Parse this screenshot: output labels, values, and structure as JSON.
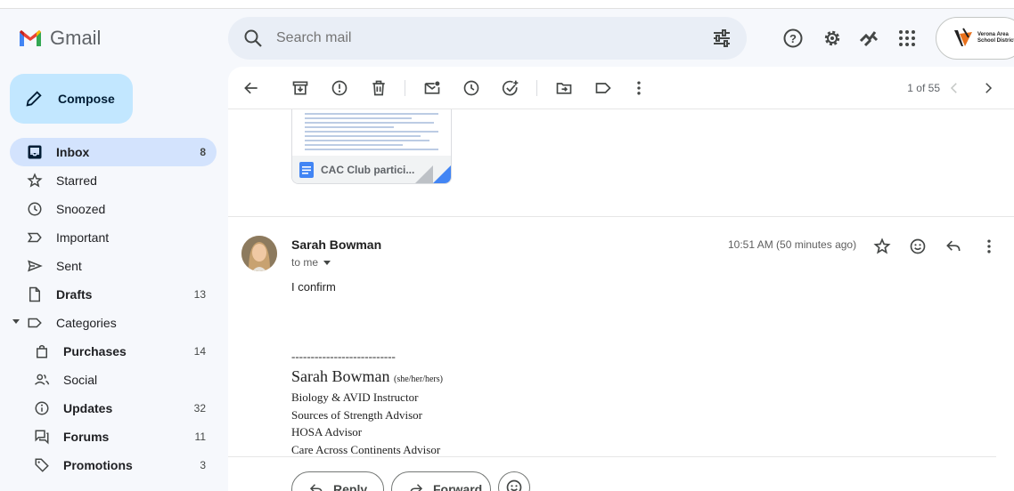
{
  "app": {
    "name": "Gmail"
  },
  "search": {
    "placeholder": "Search mail"
  },
  "account": {
    "org": "Verona Area School District"
  },
  "compose": {
    "label": "Compose"
  },
  "sidebar": {
    "items": [
      {
        "label": "Inbox",
        "count": "8"
      },
      {
        "label": "Starred",
        "count": ""
      },
      {
        "label": "Snoozed",
        "count": ""
      },
      {
        "label": "Important",
        "count": ""
      },
      {
        "label": "Sent",
        "count": ""
      },
      {
        "label": "Drafts",
        "count": "13"
      },
      {
        "label": "Categories",
        "count": ""
      },
      {
        "label": "Purchases",
        "count": "14"
      },
      {
        "label": "Social",
        "count": ""
      },
      {
        "label": "Updates",
        "count": "32"
      },
      {
        "label": "Forums",
        "count": "11"
      },
      {
        "label": "Promotions",
        "count": "3"
      }
    ]
  },
  "toolbar": {
    "pager": "1 of 55"
  },
  "attachment": {
    "name": "CAC Club partici..."
  },
  "message": {
    "sender": "Sarah Bowman",
    "to": "to me",
    "time": "10:51 AM (50 minutes ago)",
    "body": "I confirm",
    "signature": {
      "dashes": "---------------------------",
      "name": "Sarah Bowman",
      "pronouns": "(she/her/hers)",
      "lines": [
        "Biology & AVID Instructor",
        "Sources of Strength Advisor",
        "HOSA Advisor",
        "Care Across Continents Advisor"
      ]
    }
  },
  "actions": {
    "reply": "Reply",
    "forward": "Forward"
  },
  "colors": {
    "accent": "#0b57d0",
    "compose_bg": "#c2e7ff",
    "active_nav": "#d3e3fd",
    "app_bg": "#f6f8fc"
  }
}
